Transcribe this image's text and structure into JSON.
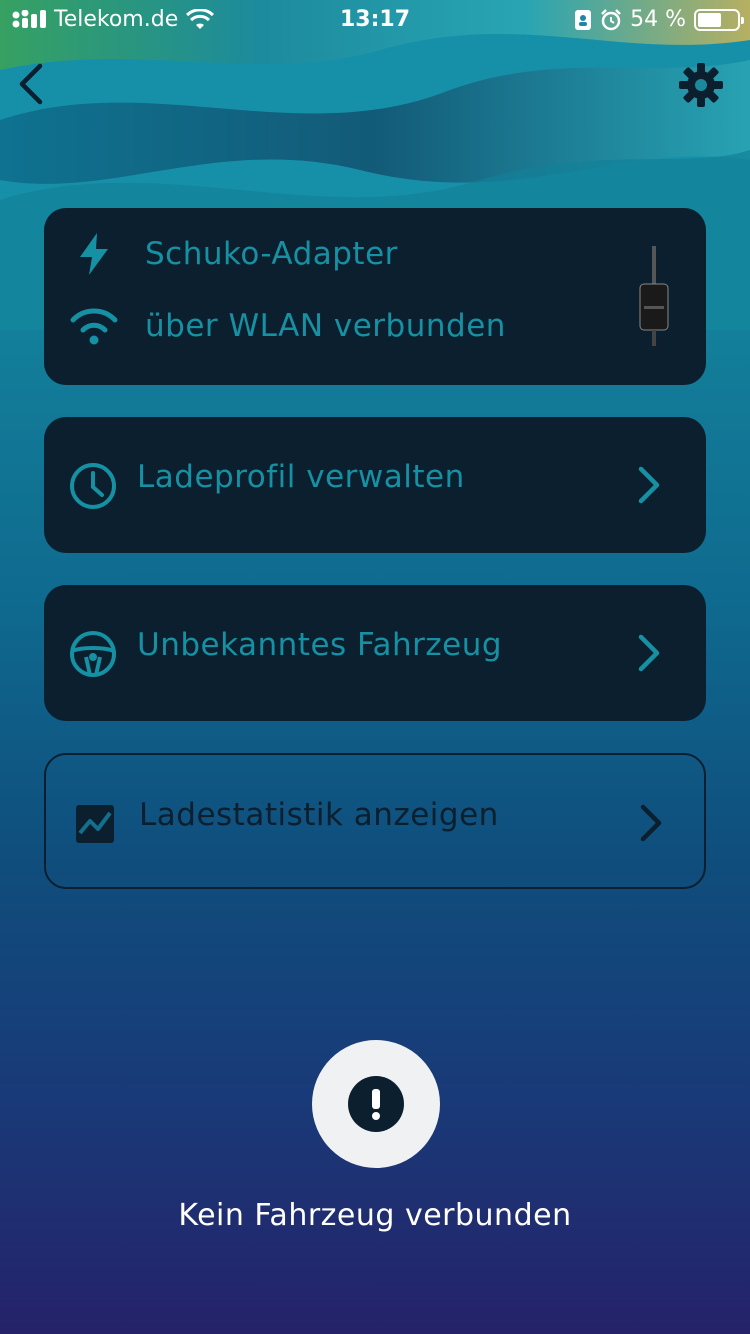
{
  "status_bar": {
    "carrier": "Telekom.de",
    "time": "13:17",
    "battery_percent": "54 %",
    "battery_level": 0.54,
    "icons": [
      "signal-icon",
      "wifi-icon",
      "portrait-lock-icon",
      "alarm-icon",
      "battery-icon"
    ]
  },
  "nav": {
    "back_icon": "chevron-left-icon",
    "settings_icon": "gear-icon"
  },
  "device": {
    "name": "Schuko-Adapter",
    "connection": "über WLAN verbunden",
    "name_icon": "lightning-icon",
    "connection_icon": "wifi-icon"
  },
  "menu": [
    {
      "label": "Ladeprofil verwalten",
      "icon": "clock-icon"
    },
    {
      "label": "Unbekanntes Fahrzeug",
      "icon": "steering-wheel-icon"
    },
    {
      "label": "Ladestatistik anzeigen",
      "icon": "chart-icon"
    }
  ],
  "alert": {
    "message": "Kein Fahrzeug verbunden",
    "icon": "exclamation-icon"
  },
  "colors": {
    "accent": "#1591a3",
    "card": "#0b1f2e",
    "text_light": "#ffffff"
  }
}
